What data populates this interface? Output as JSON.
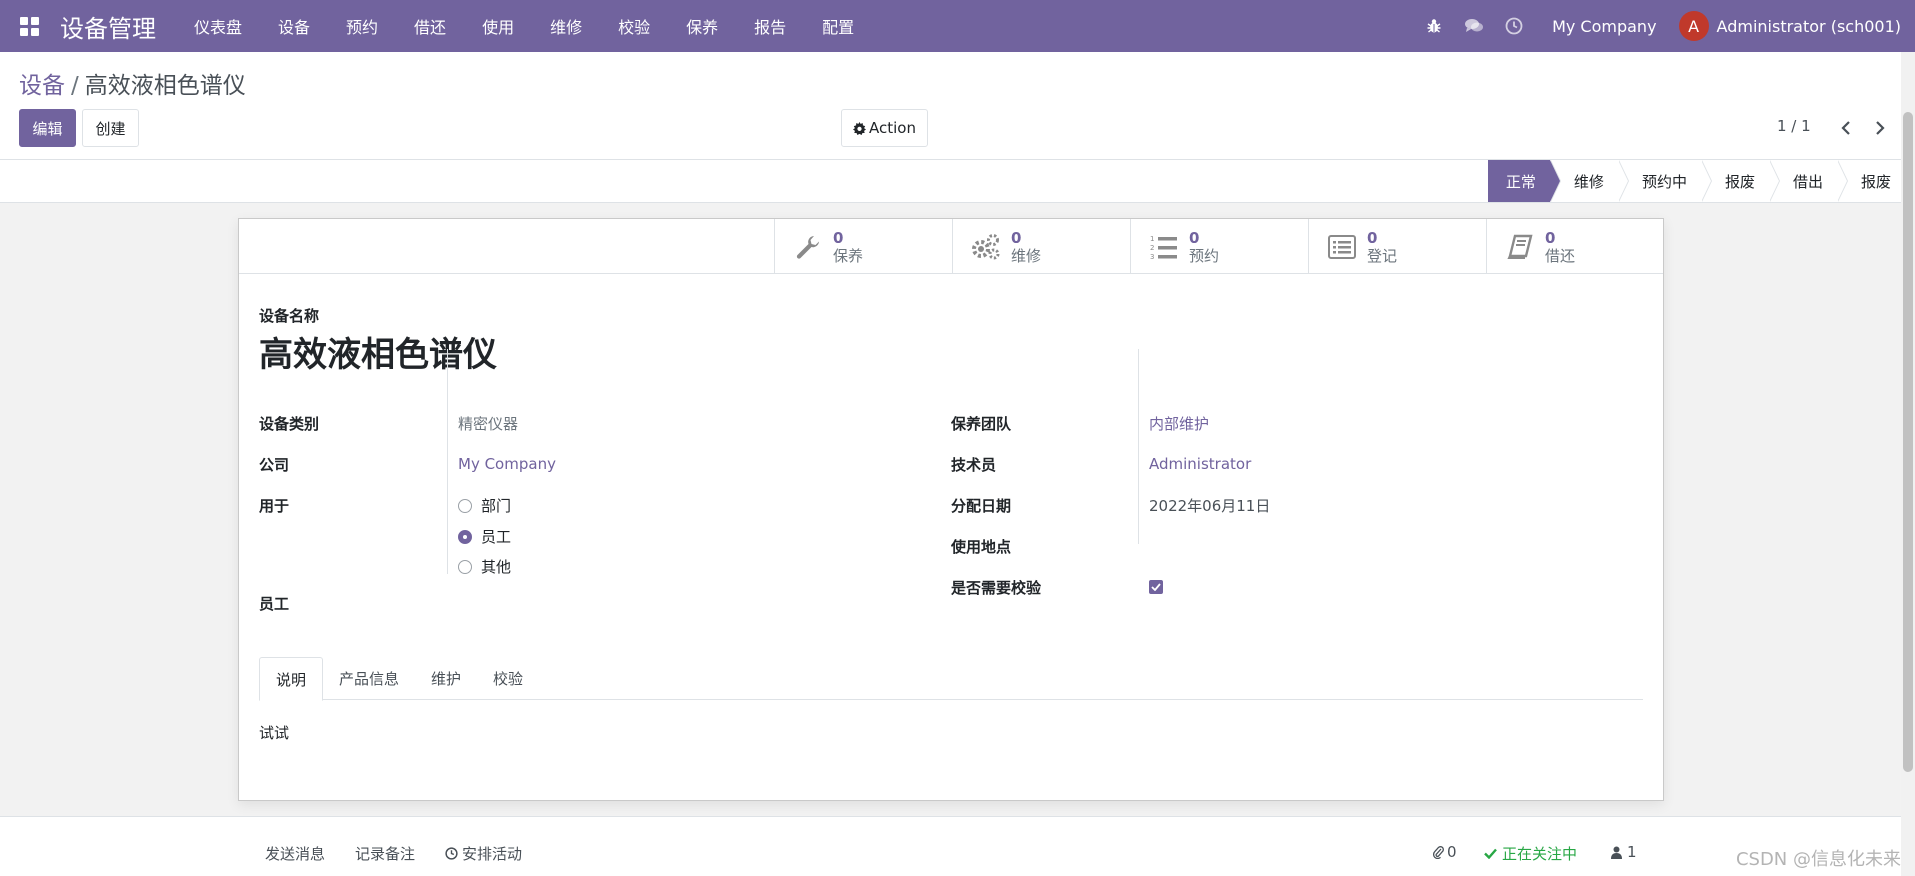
{
  "navbar": {
    "app_name": "设备管理",
    "menu": [
      "仪表盘",
      "设备",
      "预约",
      "借还",
      "使用",
      "维修",
      "校验",
      "保养",
      "报告",
      "配置"
    ],
    "company": "My Company",
    "user_initial": "A",
    "user_name": "Administrator (sch001)"
  },
  "breadcrumb": {
    "parent": "设备",
    "separator": "/",
    "current": "高效液相色谱仪"
  },
  "buttons": {
    "edit": "编辑",
    "create": "创建",
    "action": "Action"
  },
  "pager": {
    "text": "1 / 1"
  },
  "stages": [
    {
      "label": "正常",
      "active": true
    },
    {
      "label": "维修",
      "active": false
    },
    {
      "label": "预约中",
      "active": false
    },
    {
      "label": "报废",
      "active": false
    },
    {
      "label": "借出",
      "active": false
    },
    {
      "label": "报废",
      "active": false
    }
  ],
  "stat_buttons": [
    {
      "value": "0",
      "label": "保养",
      "icon": "wrench-icon"
    },
    {
      "value": "0",
      "label": "维修",
      "icon": "gears-icon"
    },
    {
      "value": "0",
      "label": "预约",
      "icon": "list-ol-icon"
    },
    {
      "value": "0",
      "label": "登记",
      "icon": "list-alt-icon"
    },
    {
      "value": "0",
      "label": "借还",
      "icon": "book-icon"
    }
  ],
  "record": {
    "name_label": "设备名称",
    "name": "高效液相色谱仪",
    "fields_left": {
      "category_label": "设备类别",
      "category": "精密仪器",
      "company_label": "公司",
      "company": "My Company",
      "used_for_label": "用于",
      "used_for_options": [
        "部门",
        "员工",
        "其他"
      ],
      "used_for_selected": "员工",
      "employee_label": "员工",
      "employee": ""
    },
    "fields_right": {
      "team_label": "保养团队",
      "team": "内部维护",
      "technician_label": "技术员",
      "technician": "Administrator",
      "assign_date_label": "分配日期",
      "assign_date": "2022年06月11日",
      "location_label": "使用地点",
      "location": "",
      "calibration_label": "是否需要校验",
      "calibration": true
    }
  },
  "tabs": [
    {
      "label": "说明",
      "active": true
    },
    {
      "label": "产品信息",
      "active": false
    },
    {
      "label": "维护",
      "active": false
    },
    {
      "label": "校验",
      "active": false
    }
  ],
  "tab_content": "试试",
  "chatter": {
    "send_message": "发送消息",
    "log_note": "记录备注",
    "schedule_activity": "安排活动",
    "attachments": "0",
    "following": "正在关注中",
    "followers": "1"
  },
  "watermark": "CSDN @信息化未来",
  "colors": {
    "brand": "#71639e",
    "follow": "#28a745",
    "avatar": "#c0392b"
  }
}
